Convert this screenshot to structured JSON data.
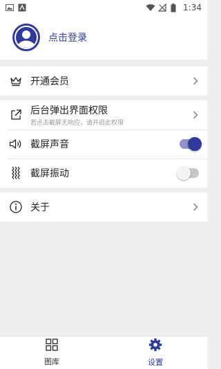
{
  "status_bar": {
    "time": "1:34"
  },
  "profile": {
    "login_label": "点击登录"
  },
  "membership": {
    "title": "开通会员"
  },
  "settings": {
    "background_popup": {
      "title": "后台弹出界面权限",
      "subtitle": "若点击截屏无响应，请开启此权限"
    },
    "screenshot_sound": {
      "title": "截屏声音",
      "enabled": true
    },
    "screenshot_vibration": {
      "title": "截屏振动",
      "enabled": false
    }
  },
  "about": {
    "title": "关于"
  },
  "bottom_nav": {
    "items": [
      {
        "label": "图库",
        "icon": "grid-icon",
        "active": false
      },
      {
        "label": "设置",
        "icon": "gear-icon",
        "active": true
      }
    ]
  },
  "colors": {
    "accent": "#2f3a9a",
    "background": "#efefef"
  }
}
